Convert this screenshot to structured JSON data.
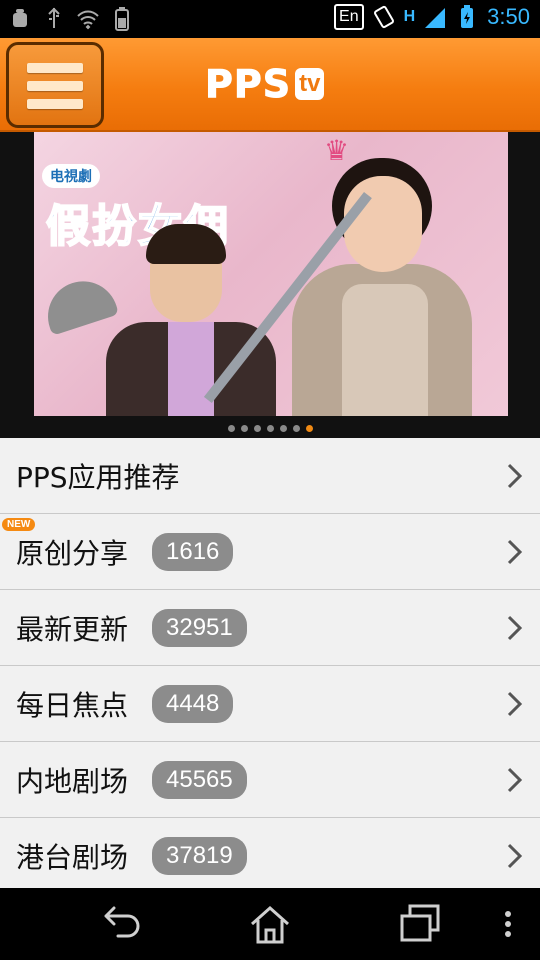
{
  "status_bar": {
    "left_icons": [
      "android-debug-icon",
      "usb-icon",
      "wifi-icon",
      "battery-saver-icon"
    ],
    "ime_label": "En",
    "network_label": "H",
    "clock": "3:50"
  },
  "header": {
    "logo_main": "PPS",
    "logo_suffix": "tv"
  },
  "banner": {
    "tag": "电視劇",
    "title": "假扮女佣",
    "dots_total": 7,
    "active_dot": 6
  },
  "list": {
    "items": [
      {
        "label": "PPS应用推荐",
        "count": null,
        "is_new": false
      },
      {
        "label": "原创分享",
        "count": "1616",
        "is_new": true,
        "new_label": "NEW"
      },
      {
        "label": "最新更新",
        "count": "32951",
        "is_new": false
      },
      {
        "label": "每日焦点",
        "count": "4448",
        "is_new": false
      },
      {
        "label": "内地剧场",
        "count": "45565",
        "is_new": false
      },
      {
        "label": "港台剧场",
        "count": "37819",
        "is_new": false
      }
    ]
  },
  "colors": {
    "header_orange": "#f57d10",
    "accent_blue": "#39b9ff",
    "badge_gray": "#8c8c8c",
    "new_badge": "#f58a12"
  }
}
